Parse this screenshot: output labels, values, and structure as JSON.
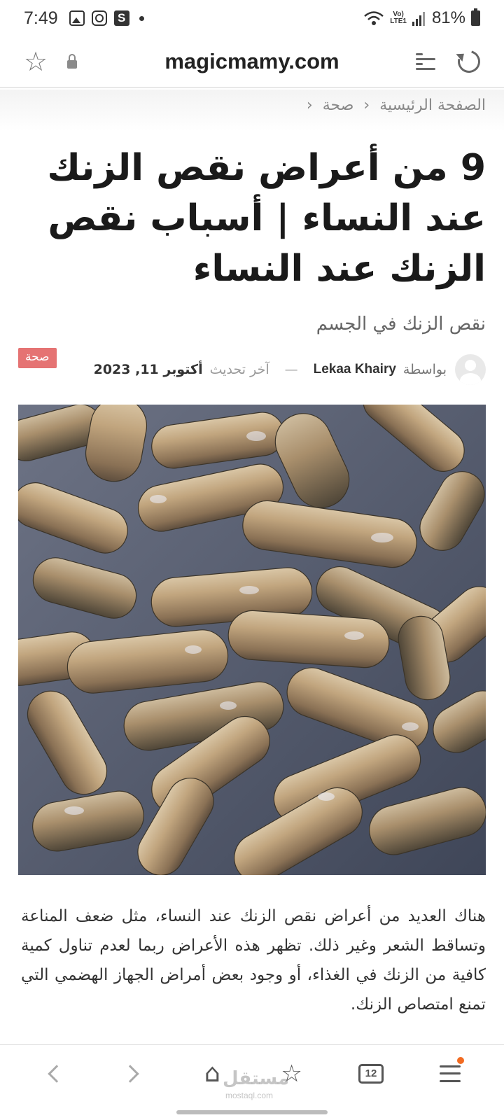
{
  "status_bar": {
    "time": "7:49",
    "network_top": "Vo)",
    "network_bottom": "LTE1",
    "battery": "81%"
  },
  "browser": {
    "url": "magicmamy.com",
    "tab_count": "12"
  },
  "breadcrumb": {
    "home": "الصفحة الرئيسية",
    "category": "صحة",
    "separator": "‹"
  },
  "article": {
    "title": "9 من أعراض نقص الزنك عند النساء | أسباب نقص الزنك عند النساء",
    "subtitle": "نقص الزنك في الجسم",
    "by_label": "بواسطة",
    "author": "Lekaa Khairy",
    "dash": "—",
    "updated_label": "آخر تحديث",
    "date": "أكتوبر 11, 2023",
    "category_badge": "صحة",
    "body": "هناك العديد من أعراض نقص الزنك عند النساء، مثل ضعف المناعة وتساقط الشعر وغير ذلك. تظهر هذه الأعراض ربما لعدم تناول كمية كافية من الزنك في الغذاء، أو وجود بعض أمراض الجهاز الهضمي التي تمنع امتصاص الزنك."
  },
  "watermark": {
    "text": "مستقل",
    "sub": "mostaql.com"
  },
  "colors": {
    "badge": "#e57373",
    "notification": "#f26b21"
  }
}
